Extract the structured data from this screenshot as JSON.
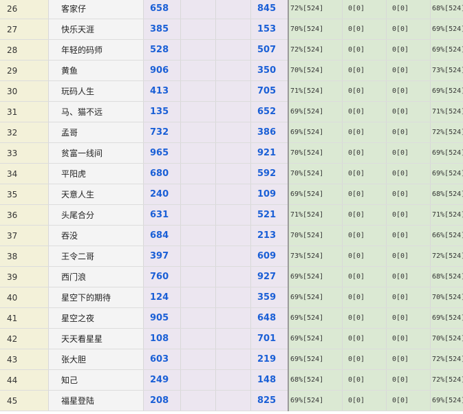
{
  "rows": [
    {
      "rank": "26",
      "name": "客家仔",
      "v1": "658",
      "v2": "845",
      "p1": "72%[524]",
      "z1": "0[0]",
      "z2": "0[0]",
      "p2": "68%[524]"
    },
    {
      "rank": "27",
      "name": "快乐天涯",
      "v1": "385",
      "v2": "153",
      "p1": "70%[524]",
      "z1": "0[0]",
      "z2": "0[0]",
      "p2": "69%[524]"
    },
    {
      "rank": "28",
      "name": "年轻的码师",
      "v1": "528",
      "v2": "507",
      "p1": "72%[524]",
      "z1": "0[0]",
      "z2": "0[0]",
      "p2": "69%[524]"
    },
    {
      "rank": "29",
      "name": "黄鱼",
      "v1": "906",
      "v2": "350",
      "p1": "70%[524]",
      "z1": "0[0]",
      "z2": "0[0]",
      "p2": "73%[524]"
    },
    {
      "rank": "30",
      "name": "玩码人生",
      "v1": "413",
      "v2": "705",
      "p1": "71%[524]",
      "z1": "0[0]",
      "z2": "0[0]",
      "p2": "69%[524]"
    },
    {
      "rank": "31",
      "name": "马、猫不远",
      "v1": "135",
      "v2": "652",
      "p1": "69%[524]",
      "z1": "0[0]",
      "z2": "0[0]",
      "p2": "71%[524]"
    },
    {
      "rank": "32",
      "name": "孟哥",
      "v1": "732",
      "v2": "386",
      "p1": "69%[524]",
      "z1": "0[0]",
      "z2": "0[0]",
      "p2": "72%[524]"
    },
    {
      "rank": "33",
      "name": "贫富一线间",
      "v1": "965",
      "v2": "921",
      "p1": "70%[524]",
      "z1": "0[0]",
      "z2": "0[0]",
      "p2": "69%[524]"
    },
    {
      "rank": "34",
      "name": "平阳虎",
      "v1": "680",
      "v2": "592",
      "p1": "70%[524]",
      "z1": "0[0]",
      "z2": "0[0]",
      "p2": "69%[524]"
    },
    {
      "rank": "35",
      "name": "天意人生",
      "v1": "240",
      "v2": "109",
      "p1": "69%[524]",
      "z1": "0[0]",
      "z2": "0[0]",
      "p2": "68%[524]"
    },
    {
      "rank": "36",
      "name": "头尾合分",
      "v1": "631",
      "v2": "521",
      "p1": "71%[524]",
      "z1": "0[0]",
      "z2": "0[0]",
      "p2": "71%[524]"
    },
    {
      "rank": "37",
      "name": "吞没",
      "v1": "684",
      "v2": "213",
      "p1": "70%[524]",
      "z1": "0[0]",
      "z2": "0[0]",
      "p2": "66%[524]"
    },
    {
      "rank": "38",
      "name": "王令二哥",
      "v1": "397",
      "v2": "609",
      "p1": "73%[524]",
      "z1": "0[0]",
      "z2": "0[0]",
      "p2": "72%[524]"
    },
    {
      "rank": "39",
      "name": "西门浪",
      "v1": "760",
      "v2": "927",
      "p1": "69%[524]",
      "z1": "0[0]",
      "z2": "0[0]",
      "p2": "68%[524]"
    },
    {
      "rank": "40",
      "name": "星空下的期待",
      "v1": "124",
      "v2": "359",
      "p1": "69%[524]",
      "z1": "0[0]",
      "z2": "0[0]",
      "p2": "70%[524]"
    },
    {
      "rank": "41",
      "name": "星空之夜",
      "v1": "905",
      "v2": "648",
      "p1": "69%[524]",
      "z1": "0[0]",
      "z2": "0[0]",
      "p2": "69%[524]"
    },
    {
      "rank": "42",
      "name": "天天看星星",
      "v1": "108",
      "v2": "701",
      "p1": "69%[524]",
      "z1": "0[0]",
      "z2": "0[0]",
      "p2": "70%[524]"
    },
    {
      "rank": "43",
      "name": "张大胆",
      "v1": "603",
      "v2": "219",
      "p1": "69%[524]",
      "z1": "0[0]",
      "z2": "0[0]",
      "p2": "72%[524]"
    },
    {
      "rank": "44",
      "name": "知己",
      "v1": "249",
      "v2": "148",
      "p1": "68%[524]",
      "z1": "0[0]",
      "z2": "0[0]",
      "p2": "72%[524]"
    },
    {
      "rank": "45",
      "name": "福星登陆",
      "v1": "208",
      "v2": "825",
      "p1": "69%[524]",
      "z1": "0[0]",
      "z2": "0[0]",
      "p2": "69%[524]"
    }
  ]
}
